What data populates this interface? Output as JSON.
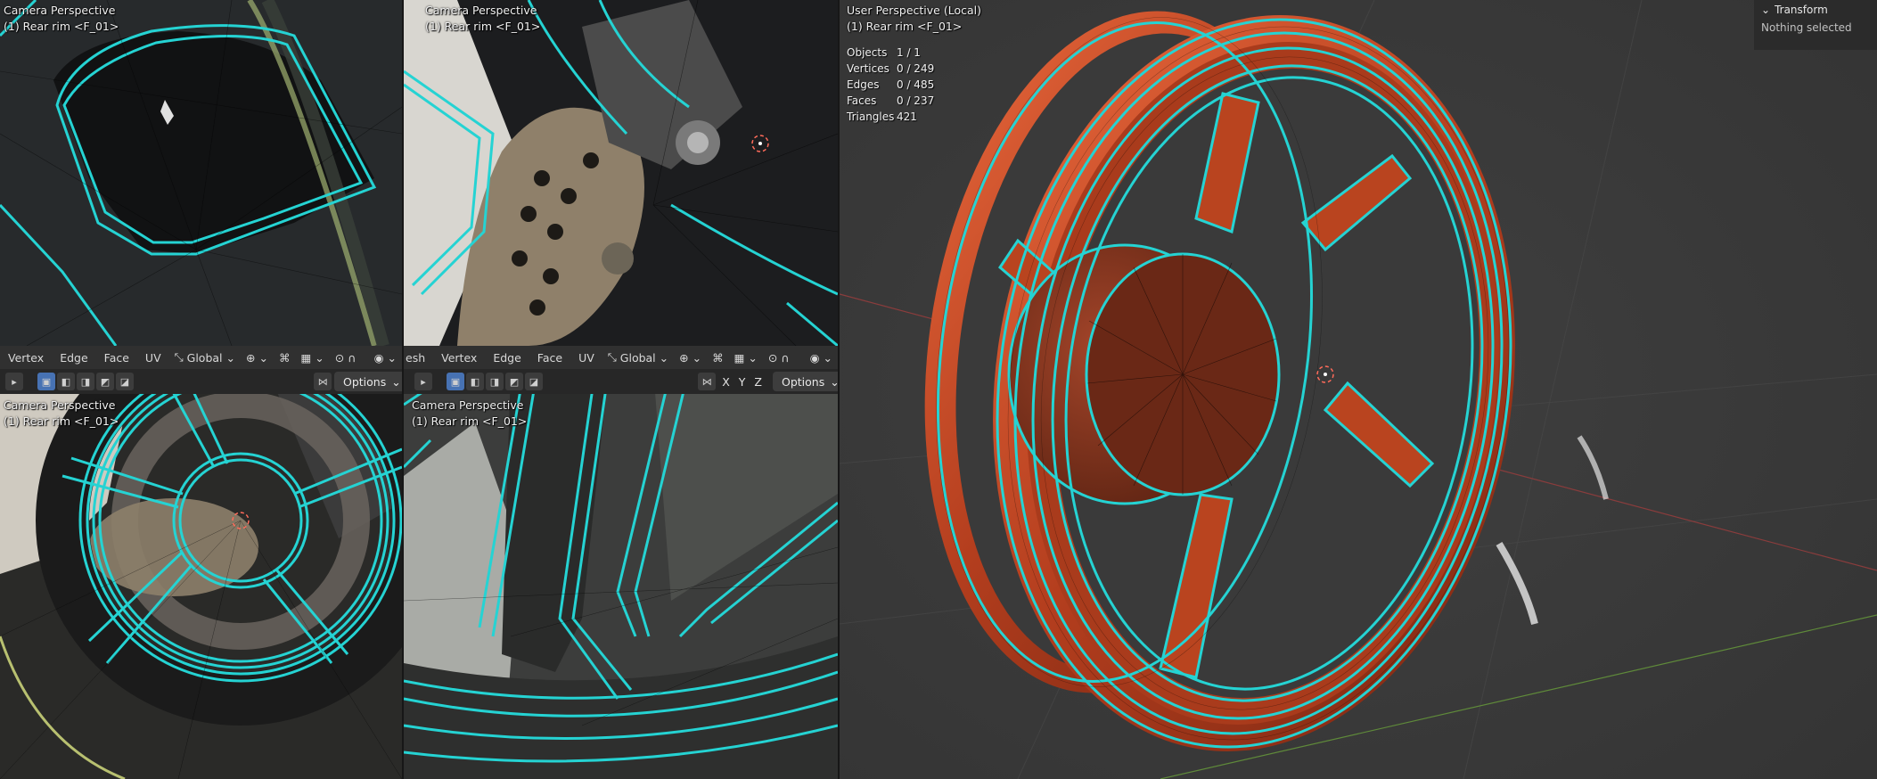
{
  "colors": {
    "wire": "#25d3d3",
    "rim": "#d2502b",
    "bg3d": "#3a3a3a",
    "panel": "#303030",
    "active": "#4772b3"
  },
  "viewports": {
    "top_left": {
      "title": "Camera Perspective",
      "object": "(1) Rear rim <F_01>"
    },
    "top_mid": {
      "title": "Camera Perspective",
      "object": "(1) Rear rim <F_01>"
    },
    "bottom_left": {
      "title": "Camera Perspective",
      "object": "(1) Rear rim <F_01>"
    },
    "bottom_mid": {
      "title": "Camera Perspective",
      "object": "(1) Rear rim <F_01>"
    },
    "main": {
      "title": "User Perspective (Local)",
      "object": "(1) Rear rim <F_01>"
    }
  },
  "header_left": {
    "menus": [
      "Vertex",
      "Edge",
      "Face",
      "UV"
    ],
    "orientation": "Global"
  },
  "header_mid": {
    "menus": [
      "esh",
      "Vertex",
      "Edge",
      "Face",
      "UV"
    ],
    "orientation": "Global"
  },
  "toolbar": {
    "axes": [
      "X",
      "Y",
      "Z"
    ],
    "options_label": "Options"
  },
  "stats": [
    {
      "label": "Objects",
      "value": "1 / 1"
    },
    {
      "label": "Vertices",
      "value": "0 / 249"
    },
    {
      "label": "Edges",
      "value": "0 / 485"
    },
    {
      "label": "Faces",
      "value": "0 / 237"
    },
    {
      "label": "Triangles",
      "value": "421"
    }
  ],
  "n_panel": {
    "section": "Transform",
    "empty_text": "Nothing selected"
  },
  "icons": [
    "cursor-3d-icon",
    "global-orientation-icon",
    "snap-icon",
    "proportional-edit-icon",
    "visibility-icon",
    "select-mode-icon",
    "chevron-down-icon",
    "x-mirror-icon"
  ]
}
